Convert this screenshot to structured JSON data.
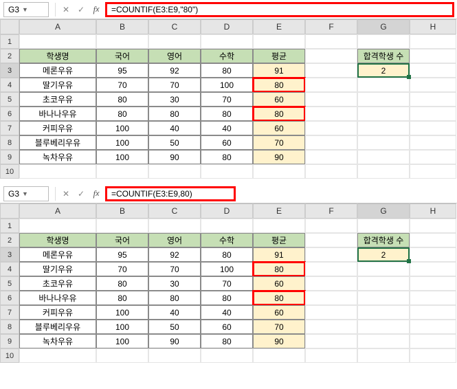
{
  "block1": {
    "namebox": "G3",
    "formula": "=COUNTIF(E3:E9,\"80\")",
    "cols": [
      "A",
      "B",
      "C",
      "D",
      "E",
      "F",
      "G",
      "H"
    ],
    "rows": [
      "1",
      "2",
      "3",
      "4",
      "5",
      "6",
      "7",
      "8",
      "9",
      "10"
    ],
    "headers": {
      "name": "학생명",
      "kor": "국어",
      "eng": "영어",
      "math": "수학",
      "avg": "평균"
    },
    "data": [
      {
        "name": "메론우유",
        "kor": "95",
        "eng": "92",
        "math": "80",
        "avg": "91",
        "red": false
      },
      {
        "name": "딸기우유",
        "kor": "70",
        "eng": "70",
        "math": "100",
        "avg": "80",
        "red": true
      },
      {
        "name": "초코우유",
        "kor": "80",
        "eng": "30",
        "math": "70",
        "avg": "60",
        "red": false
      },
      {
        "name": "바나나우유",
        "kor": "80",
        "eng": "80",
        "math": "80",
        "avg": "80",
        "red": true
      },
      {
        "name": "커피우유",
        "kor": "100",
        "eng": "40",
        "math": "40",
        "avg": "60",
        "red": false
      },
      {
        "name": "블루베리우유",
        "kor": "100",
        "eng": "50",
        "math": "60",
        "avg": "70",
        "red": false
      },
      {
        "name": "녹차우유",
        "kor": "100",
        "eng": "90",
        "math": "80",
        "avg": "90",
        "red": false
      }
    ],
    "result_hdr": "합격학생 수",
    "result_val": "2"
  },
  "block2": {
    "namebox": "G3",
    "formula": "=COUNTIF(E3:E9,80)",
    "cols": [
      "A",
      "B",
      "C",
      "D",
      "E",
      "F",
      "G",
      "H"
    ],
    "rows": [
      "1",
      "2",
      "3",
      "4",
      "5",
      "6",
      "7",
      "8",
      "9",
      "10"
    ],
    "headers": {
      "name": "학생명",
      "kor": "국어",
      "eng": "영어",
      "math": "수학",
      "avg": "평균"
    },
    "data": [
      {
        "name": "메론우유",
        "kor": "95",
        "eng": "92",
        "math": "80",
        "avg": "91",
        "red": false
      },
      {
        "name": "딸기우유",
        "kor": "70",
        "eng": "70",
        "math": "100",
        "avg": "80",
        "red": true
      },
      {
        "name": "초코우유",
        "kor": "80",
        "eng": "30",
        "math": "70",
        "avg": "60",
        "red": false
      },
      {
        "name": "바나나우유",
        "kor": "80",
        "eng": "80",
        "math": "80",
        "avg": "80",
        "red": true
      },
      {
        "name": "커피우유",
        "kor": "100",
        "eng": "40",
        "math": "40",
        "avg": "60",
        "red": false
      },
      {
        "name": "블루베리우유",
        "kor": "100",
        "eng": "50",
        "math": "60",
        "avg": "70",
        "red": false
      },
      {
        "name": "녹차우유",
        "kor": "100",
        "eng": "90",
        "math": "80",
        "avg": "90",
        "red": false
      }
    ],
    "result_hdr": "합격학생 수",
    "result_val": "2"
  }
}
